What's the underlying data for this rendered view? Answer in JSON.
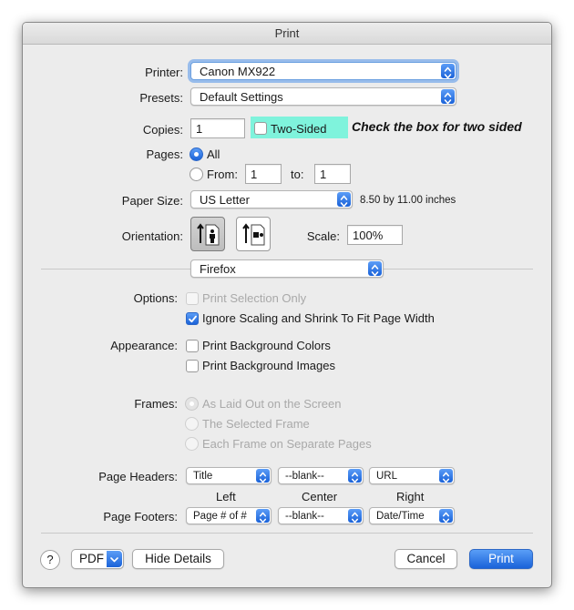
{
  "window": {
    "title": "Print"
  },
  "printer": {
    "label": "Printer:",
    "value": "Canon MX922"
  },
  "presets": {
    "label": "Presets:",
    "value": "Default Settings"
  },
  "copies": {
    "label": "Copies:",
    "value": "1",
    "two_sided_label": "Two-Sided",
    "two_sided_checked": false
  },
  "annotation": {
    "text": "Check  the box for two sided",
    "highlight_color": "#7ff3dc"
  },
  "pages": {
    "label": "Pages:",
    "all_label": "All",
    "from_label": "From:",
    "from_value": "1",
    "to_label": "to:",
    "to_value": "1",
    "selected": "All"
  },
  "paper_size": {
    "label": "Paper Size:",
    "value": "US Letter",
    "dimensions": "8.50 by 11.00 inches"
  },
  "orientation": {
    "label": "Orientation:",
    "selected": "portrait",
    "portrait_icon": "portrait-orientation-icon",
    "landscape_icon": "landscape-orientation-icon"
  },
  "scale": {
    "label": "Scale:",
    "value": "100%"
  },
  "section": {
    "value": "Firefox"
  },
  "options": {
    "label": "Options:",
    "print_selection_only": {
      "label": "Print Selection Only",
      "checked": false,
      "enabled": false
    },
    "ignore_scaling": {
      "label": "Ignore Scaling and Shrink To Fit Page Width",
      "checked": true,
      "enabled": true
    }
  },
  "appearance": {
    "label": "Appearance:",
    "background_colors": {
      "label": "Print Background Colors",
      "checked": false
    },
    "background_images": {
      "label": "Print Background Images",
      "checked": false
    }
  },
  "frames": {
    "label": "Frames:",
    "as_laid_out": "As Laid Out on the Screen",
    "selected_frame": "The Selected Frame",
    "each_frame": "Each Frame on Separate Pages",
    "selected": "As Laid Out on the Screen",
    "enabled": false
  },
  "headers": {
    "label": "Page Headers:",
    "left": "Title",
    "center": "--blank--",
    "right": "URL"
  },
  "columns": {
    "left": "Left",
    "center": "Center",
    "right": "Right"
  },
  "footers": {
    "label": "Page Footers:",
    "left": "Page # of #",
    "center": "--blank--",
    "right": "Date/Time"
  },
  "bottom": {
    "help_label": "?",
    "pdf_label": "PDF",
    "hide_details_label": "Hide Details",
    "cancel_label": "Cancel",
    "print_label": "Print"
  },
  "colors": {
    "accent": "#1a63d9",
    "window_bg": "#ececec"
  }
}
